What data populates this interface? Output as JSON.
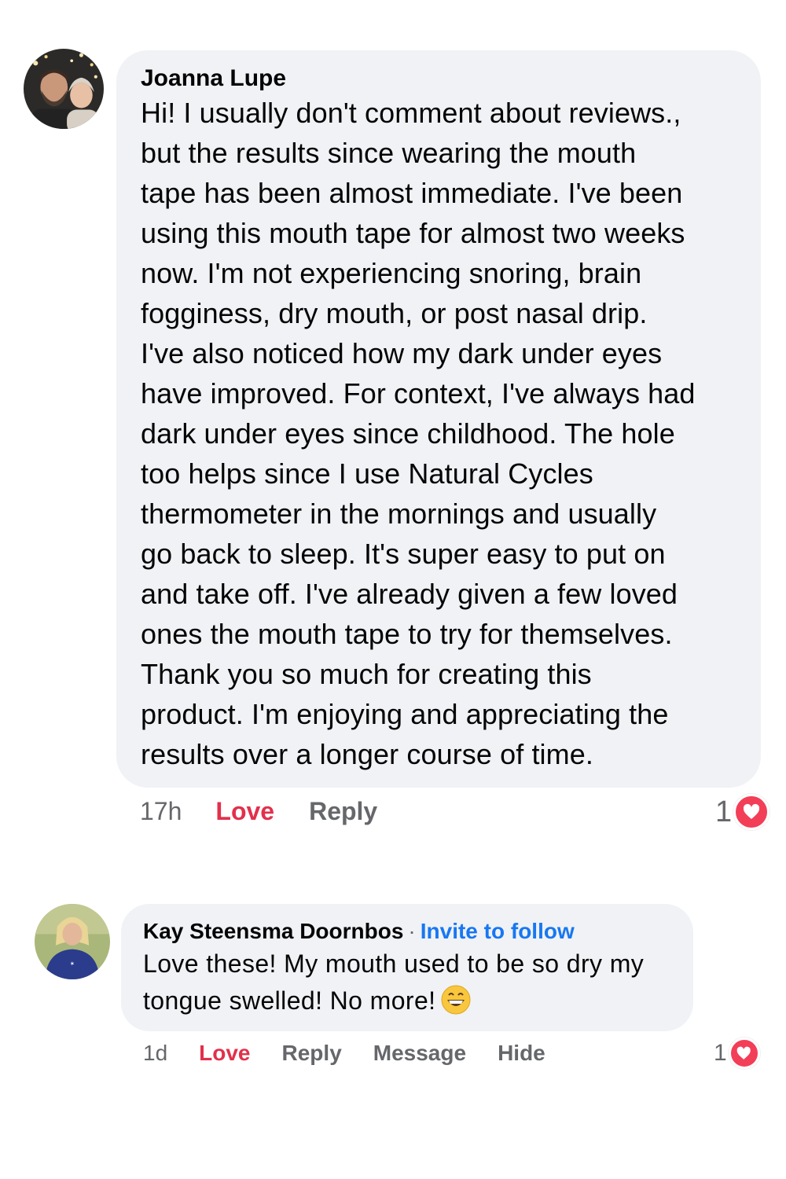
{
  "comments": [
    {
      "author": "Joanna Lupe",
      "avatar_icon": "couple-photo-avatar",
      "body_lines": [
        "Hi! I usually don't comment about reviews.,",
        "but the results since wearing the mouth",
        "tape has been almost immediate. I've been",
        "using this mouth tape for almost two weeks",
        "now. I'm not experiencing snoring, brain",
        "fogginess, dry mouth, or post nasal drip.",
        "I've also noticed how my dark under eyes",
        "have improved. For context, I've always had",
        "dark under eyes since childhood. The hole",
        "too helps since I use Natural Cycles",
        "thermometer in the mornings and usually",
        "go back to sleep. It's super easy to put on",
        "and take off. I've already given a few loved",
        "ones the mouth tape to try for themselves.",
        "Thank you so much for creating this",
        "product. I'm enjoying and appreciating the",
        "results over a longer course of time."
      ],
      "time": "17h",
      "actions": [
        "Love",
        "Reply"
      ],
      "reaction_count": "1",
      "reaction_icon": "heart-icon"
    },
    {
      "author": "Kay Steensma Doornbos",
      "separator": "·",
      "invite_label": "Invite to follow",
      "avatar_icon": "woman-photo-avatar",
      "body_lines": [
        "Love these! My mouth used to be so dry my",
        "tongue swelled! No more!"
      ],
      "emoji": "grinning-face-icon",
      "time": "1d",
      "actions": [
        "Love",
        "Reply",
        "Message",
        "Hide"
      ],
      "reaction_count": "1",
      "reaction_icon": "heart-icon"
    }
  ],
  "colors": {
    "bubble": "#f0f2f5",
    "text": "#050505",
    "meta": "#65676b",
    "love": "#e2304b",
    "link": "#1877f2",
    "heart_badge": "#f33e58"
  }
}
